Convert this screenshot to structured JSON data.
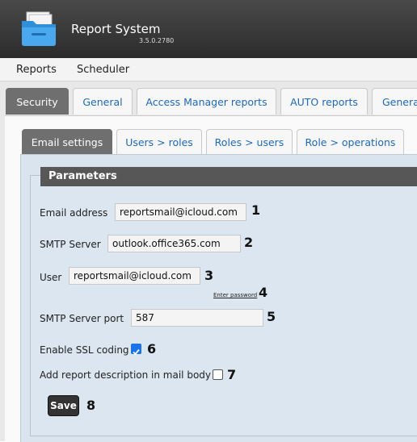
{
  "app": {
    "title": "Report System",
    "version": "3.5.0.2780"
  },
  "menu": {
    "items": [
      "Reports",
      "Scheduler"
    ]
  },
  "main_tabs": [
    {
      "label": "Security",
      "active": true
    },
    {
      "label": "General",
      "active": false
    },
    {
      "label": "Access Manager reports",
      "active": false
    },
    {
      "label": "AUTO reports",
      "active": false
    },
    {
      "label": "Genera",
      "active": false
    }
  ],
  "sub_tabs": [
    {
      "label": "Email settings",
      "active": true
    },
    {
      "label": "Users > roles",
      "active": false
    },
    {
      "label": "Roles > users",
      "active": false
    },
    {
      "label": "Role > operations",
      "active": false
    }
  ],
  "form": {
    "legend": "Parameters",
    "email_label": "Email address",
    "email_value": "reportsmail@icloud.com",
    "smtp_label": "SMTP Server",
    "smtp_value": "outlook.office365.com",
    "user_label": "User",
    "user_value": "reportsmail@icloud.com",
    "enter_password": "Enter password",
    "port_label": "SMTP Server port",
    "port_value": "587",
    "ssl_label": "Enable SSL coding",
    "ssl_checked": true,
    "desc_label": "Add report description in mail body",
    "desc_checked": false,
    "save_label": "Save"
  },
  "callouts": [
    "1",
    "2",
    "3",
    "4",
    "5",
    "6",
    "7",
    "8"
  ],
  "colors": {
    "accent": "#1a73e8",
    "tab_link": "#1f68b5",
    "active_tab": "#6f6f6f"
  }
}
